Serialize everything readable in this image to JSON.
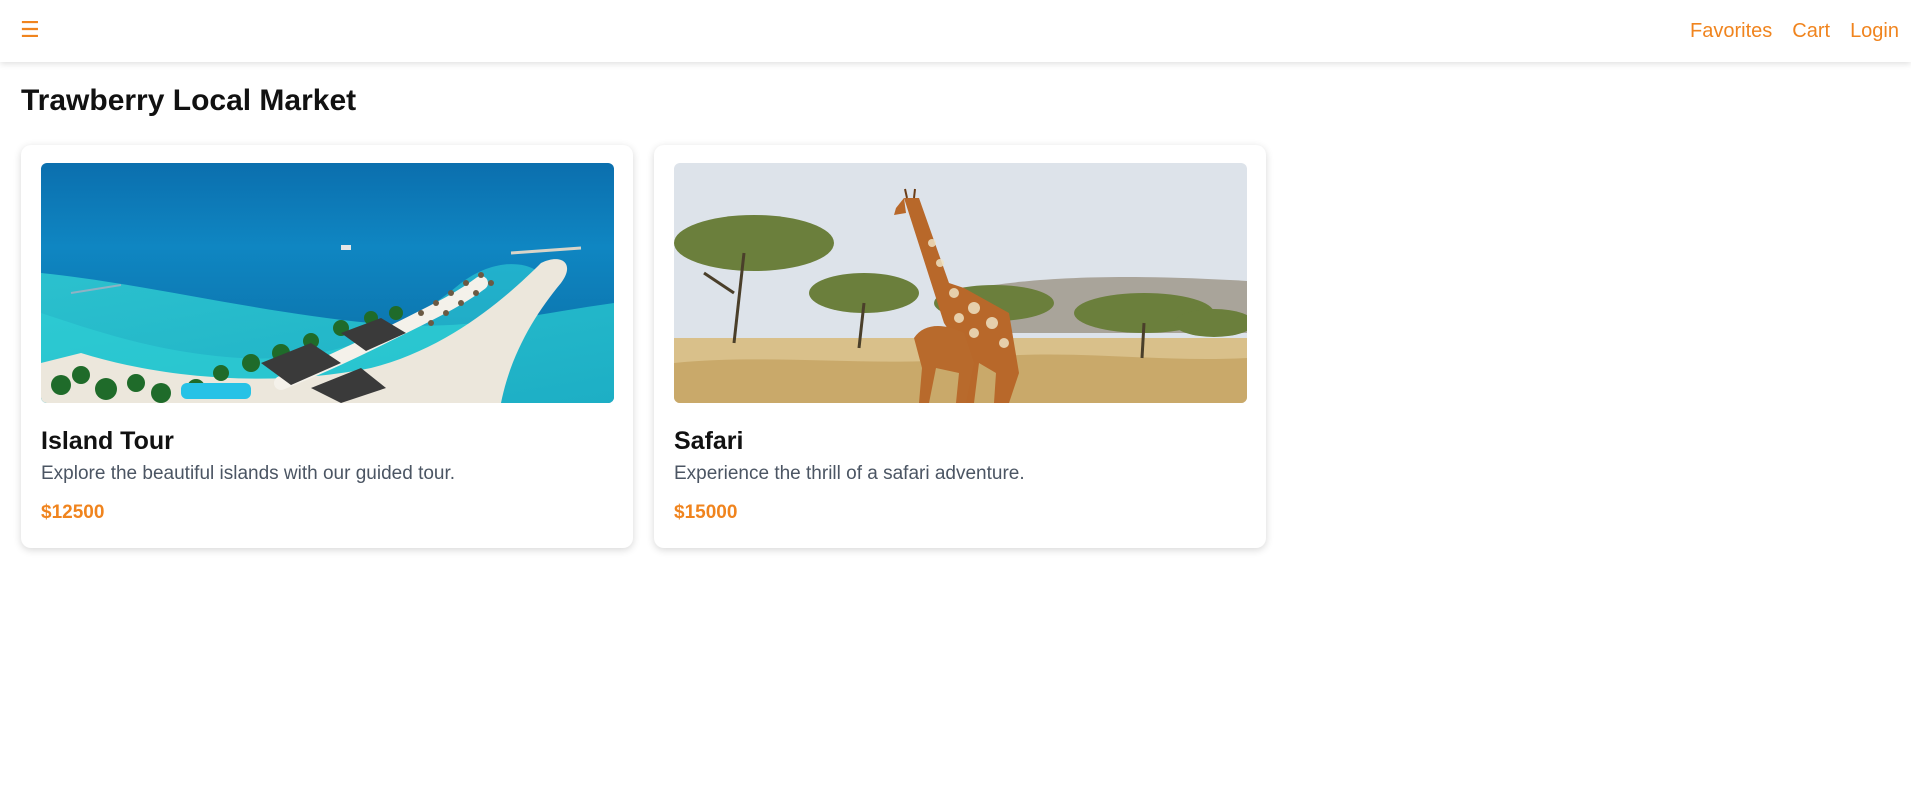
{
  "nav": {
    "menu_icon": "☰",
    "links": [
      "Favorites",
      "Cart",
      "Login"
    ]
  },
  "page": {
    "title": "Trawberry Local Market"
  },
  "products": [
    {
      "title": "Island Tour",
      "description": "Explore the beautiful islands with our guided tour.",
      "price": "$12500",
      "image": "island-beach-photo"
    },
    {
      "title": "Safari",
      "description": "Experience the thrill of a safari adventure.",
      "price": "$15000",
      "image": "giraffe-safari-photo"
    }
  ],
  "colors": {
    "accent": "#f0841e",
    "title": "#111111",
    "description": "#4b5563"
  }
}
